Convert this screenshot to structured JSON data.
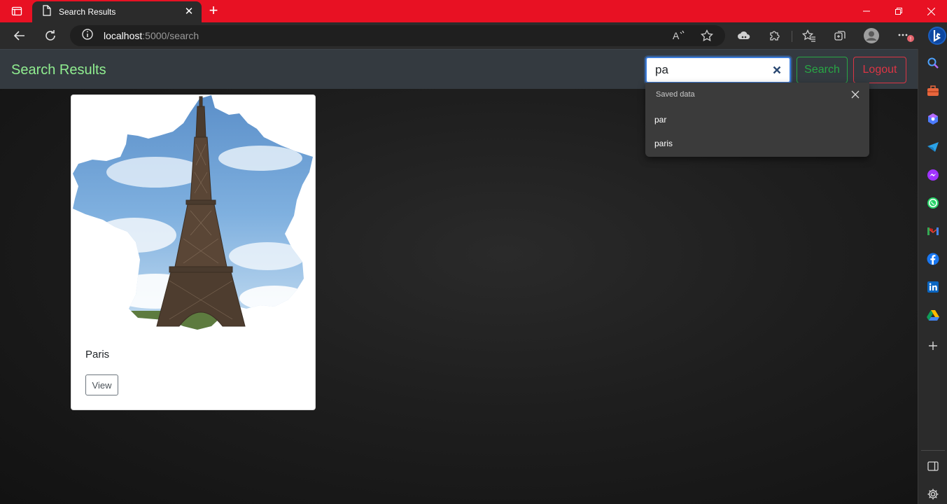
{
  "browser": {
    "tab_title": "Search Results",
    "address": {
      "host": "localhost",
      "rest": ":5000/search"
    }
  },
  "page": {
    "brand": "Search Results",
    "search": {
      "value": "pa",
      "placeholder": ""
    },
    "search_button": "Search",
    "logout_button": "Logout",
    "autocomplete": {
      "header": "Saved data",
      "items": [
        "par",
        "paris"
      ]
    },
    "results": [
      {
        "title": "Paris",
        "button": "View",
        "image": "eiffel-tower-france-map"
      }
    ]
  },
  "colors": {
    "brand": "#90ee90",
    "tabbar": "#e81123",
    "navbar": "#343a40",
    "success": "#28a745",
    "danger": "#dc3545"
  }
}
